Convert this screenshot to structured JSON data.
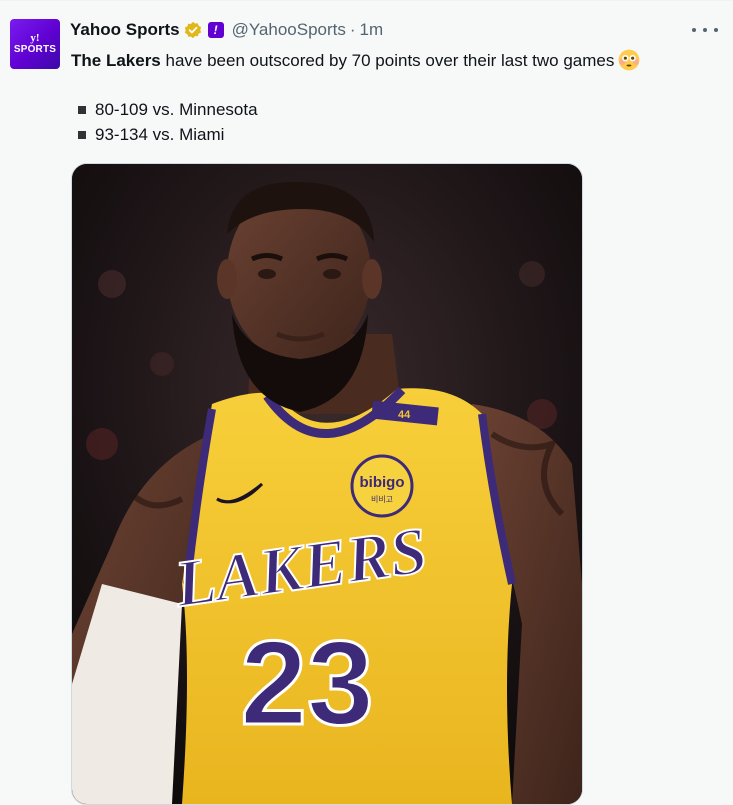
{
  "account": {
    "display_name": "Yahoo Sports",
    "handle": "@YahooSports",
    "separator": "·",
    "time": "1m",
    "avatar_text_top": "y!",
    "avatar_text_bottom": "SPORTS",
    "affiliate_badge": "!"
  },
  "tweet": {
    "bold_lead": "The Lakers",
    "text": " have been outscored by 70 points over their last two games",
    "emoji": "flushed-face-icon",
    "stats": [
      {
        "text": "80-109 vs. Minnesota"
      },
      {
        "text": "93-134 vs. Miami"
      }
    ]
  },
  "media": {
    "jersey_team": "LAKERS",
    "jersey_number": "23",
    "strap_number": "44",
    "sponsor": "bibigo",
    "sponsor_sub": "비비고"
  },
  "colors": {
    "brand": "#6001d2",
    "verified": "#e2b719",
    "jersey_gold": "#f5c72c",
    "jersey_purple": "#3d2a78"
  }
}
